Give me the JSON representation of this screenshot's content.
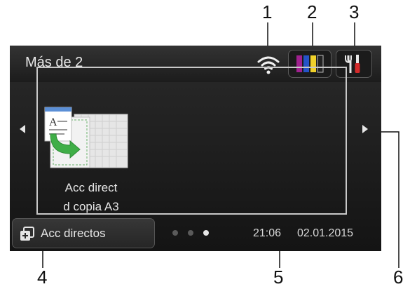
{
  "screen": {
    "title": "Más de 2",
    "tile": {
      "label_line1": "Acc direct",
      "label_line2": "d copia A3"
    },
    "shortcuts_button": {
      "label": "Acc directos"
    },
    "status": {
      "time": "21:06",
      "date": "02.01.2015"
    },
    "page_dots": {
      "count": 3,
      "active_index": 2
    },
    "colors": {
      "ink_magenta": "#a0218f",
      "ink_cyan": "#2553c8",
      "ink_yellow": "#f0d12a",
      "ink_black": "#222222",
      "tile_arrow": "#3fae47"
    }
  },
  "callouts": {
    "c1": "1",
    "c2": "2",
    "c3": "3",
    "c4": "4",
    "c5": "5",
    "c6": "6"
  },
  "icons": [
    "wifi-icon",
    "ink-levels-icon",
    "tools-icon",
    "copy-shortcut-icon",
    "shortcuts-icon"
  ]
}
